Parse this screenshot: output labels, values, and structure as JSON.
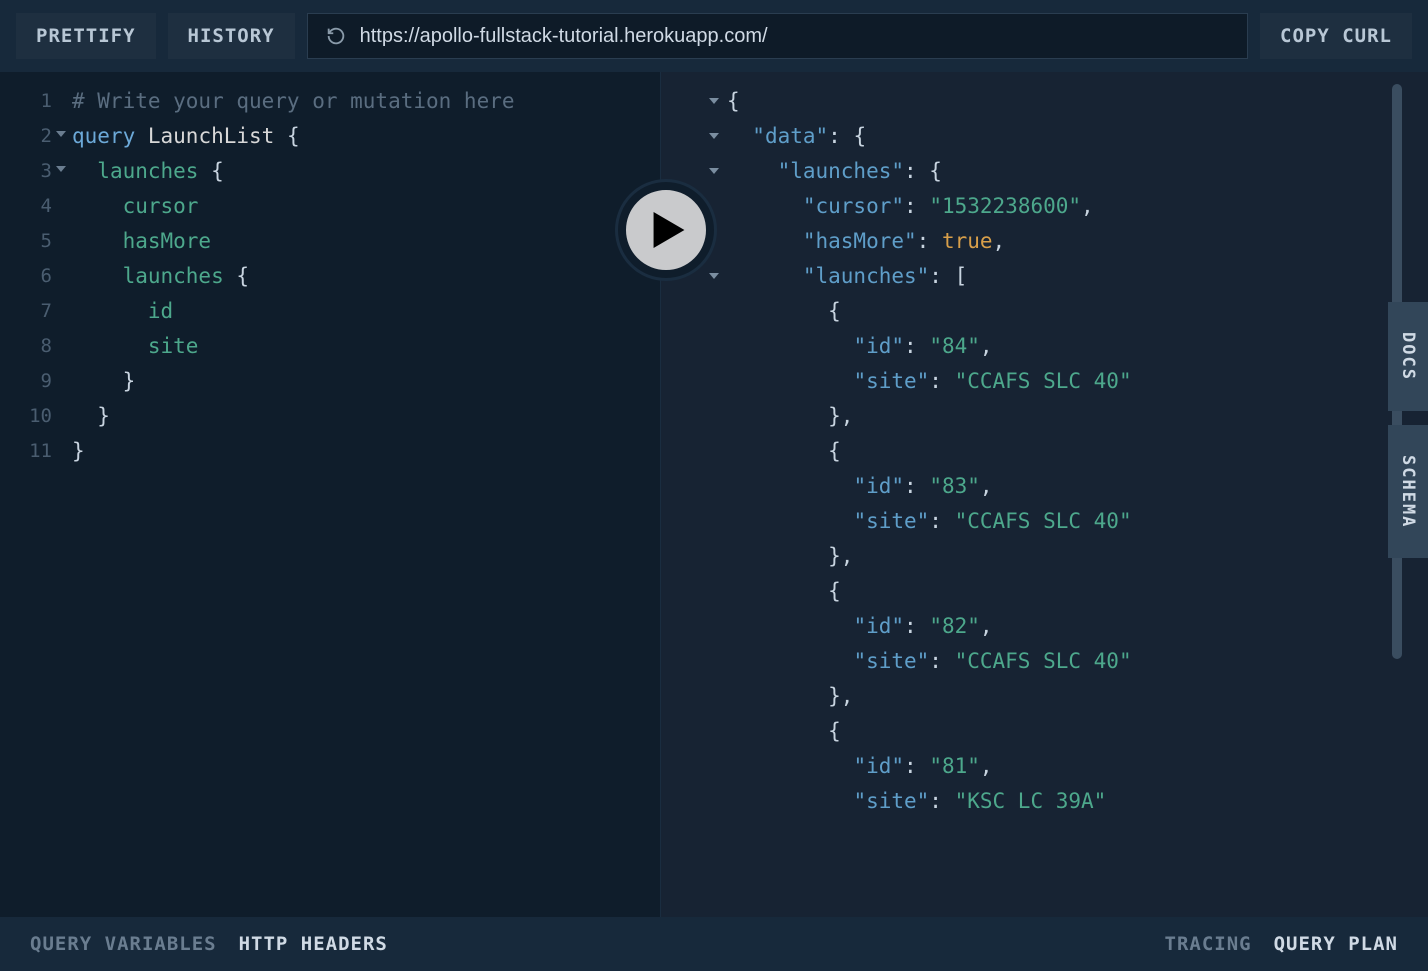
{
  "toolbar": {
    "prettify": "PRETTIFY",
    "history": "HISTORY",
    "url": "https://apollo-fullstack-tutorial.herokuapp.com/",
    "copy_curl": "COPY CURL"
  },
  "query_editor": {
    "comment": "# Write your query or mutation here",
    "keyword_query": "query",
    "operation_name": "LaunchList",
    "field_launches": "launches",
    "field_cursor": "cursor",
    "field_hasMore": "hasMore",
    "field_launches_nested": "launches",
    "field_id": "id",
    "field_site": "site",
    "line_numbers": [
      "1",
      "2",
      "3",
      "4",
      "5",
      "6",
      "7",
      "8",
      "9",
      "10",
      "11"
    ]
  },
  "response": {
    "data_key": "\"data\"",
    "launches_key": "\"launches\"",
    "cursor_key": "\"cursor\"",
    "cursor_val": "\"1532238600\"",
    "hasMore_key": "\"hasMore\"",
    "hasMore_val": "true",
    "nested_launches_key": "\"launches\"",
    "id_key": "\"id\"",
    "site_key": "\"site\"",
    "items": [
      {
        "id": "\"84\"",
        "site": "\"CCAFS SLC 40\""
      },
      {
        "id": "\"83\"",
        "site": "\"CCAFS SLC 40\""
      },
      {
        "id": "\"82\"",
        "site": "\"CCAFS SLC 40\""
      },
      {
        "id": "\"81\"",
        "site": "\"KSC LC 39A\""
      }
    ]
  },
  "side_tabs": {
    "docs": "DOCS",
    "schema": "SCHEMA"
  },
  "bottom_tabs": {
    "query_variables": "QUERY VARIABLES",
    "http_headers": "HTTP HEADERS",
    "tracing": "TRACING",
    "query_plan": "QUERY PLAN"
  }
}
